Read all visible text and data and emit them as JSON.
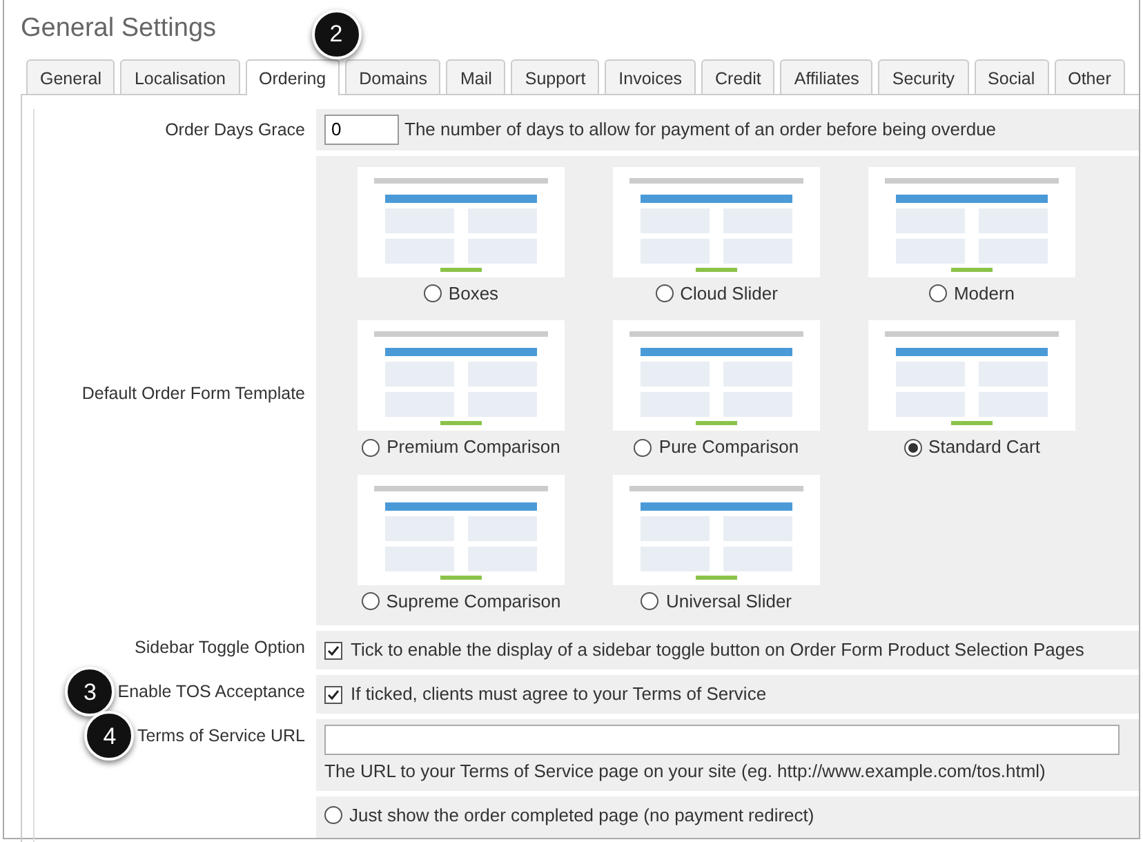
{
  "title": "General Settings",
  "tabs": [
    {
      "label": "General",
      "selected": false
    },
    {
      "label": "Localisation",
      "selected": false
    },
    {
      "label": "Ordering",
      "selected": true,
      "callout": "2"
    },
    {
      "label": "Domains",
      "selected": false
    },
    {
      "label": "Mail",
      "selected": false
    },
    {
      "label": "Support",
      "selected": false
    },
    {
      "label": "Invoices",
      "selected": false
    },
    {
      "label": "Credit",
      "selected": false
    },
    {
      "label": "Affiliates",
      "selected": false
    },
    {
      "label": "Security",
      "selected": false
    },
    {
      "label": "Social",
      "selected": false
    },
    {
      "label": "Other",
      "selected": false
    }
  ],
  "settings": [
    {
      "kind": "number",
      "label": "Order Days Grace",
      "value": "0",
      "help": "The number of days to allow for payment of an order before being overdue"
    },
    {
      "kind": "templates",
      "label": "Default Order Form Template",
      "options": [
        {
          "name": "Boxes",
          "selected": false
        },
        {
          "name": "Cloud Slider",
          "selected": false
        },
        {
          "name": "Modern",
          "selected": false
        },
        {
          "name": "Premium Comparison",
          "selected": false
        },
        {
          "name": "Pure Comparison",
          "selected": false
        },
        {
          "name": "Standard Cart",
          "selected": true
        },
        {
          "name": "Supreme Comparison",
          "selected": false
        },
        {
          "name": "Universal Slider",
          "selected": false
        }
      ]
    },
    {
      "kind": "checkbox",
      "label": "Sidebar Toggle Option",
      "checked": true,
      "text": "Tick to enable the display of a sidebar toggle button on Order Form Product Selection Pages"
    },
    {
      "kind": "checkbox",
      "label": "Enable TOS Acceptance",
      "checked": true,
      "text": "If ticked, clients must agree to your Terms of Service",
      "callout": "3"
    },
    {
      "kind": "url",
      "label": "Terms of Service URL",
      "help": "The URL to your Terms of Service page on your site (eg. http://www.example.com/tos.html)",
      "callout": "4"
    },
    {
      "kind": "radio",
      "text": "Just show the order completed page (no payment redirect)",
      "selected": false
    }
  ]
}
